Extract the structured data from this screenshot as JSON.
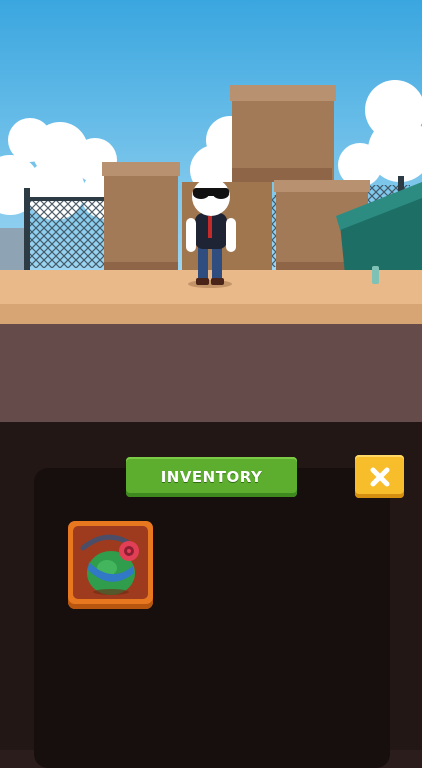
{
  "inventory": {
    "title": "INVENTORY",
    "close_icon": "x-close-icon",
    "slots": [
      {
        "item": "green-grenade-icon",
        "selected": true
      }
    ]
  },
  "colors": {
    "title_button": "#5dad2e",
    "close_button": "#f7bd2a",
    "slot": "#e8781f",
    "panel": "#170e0e"
  }
}
